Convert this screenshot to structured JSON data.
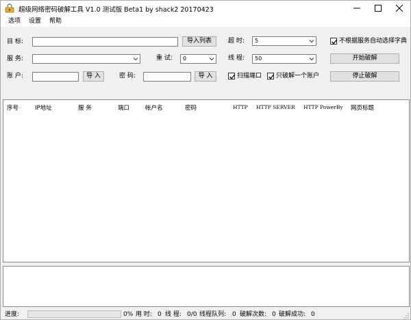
{
  "window": {
    "title": "超级网络密码破解工具 V1.0 测试版 Beta1 by shack2 20170423"
  },
  "menu": [
    "选项",
    "设置",
    "帮助"
  ],
  "form": {
    "target_label": "目 标:",
    "target_value": "",
    "import_list_button": "导入列表",
    "timeout_label": "超 时:",
    "timeout_value": "5",
    "auto_dict_label": "不根据服务自动选择字典",
    "auto_dict_checked": true,
    "service_label": "服 务:",
    "service_value": "",
    "retry_label": "重 试:",
    "retry_value": "0",
    "threads_label": "线 程:",
    "threads_value": "50",
    "start_button": "开始破解",
    "account_label": "账 户:",
    "account_value": "",
    "account_import_button": "导 入",
    "password_label": "密 码:",
    "password_value": "",
    "password_import_button": "导 入",
    "scan_port_label": "扫描端口",
    "scan_port_checked": true,
    "crack_one_label": "只破解一个账户",
    "crack_one_checked": true,
    "stop_button": "停止破解"
  },
  "table": {
    "columns": [
      "序号",
      "IP地址",
      "服 务",
      "端口",
      "帐户名",
      "密码",
      "HTTP",
      "HTTP SERVER",
      "HTTP PowerBy",
      "网页标题"
    ]
  },
  "status": {
    "progress_label": "进度:",
    "progress_percent": 0,
    "progress_text": "0%",
    "elapsed_label": "用 时:",
    "elapsed_value": "0",
    "threads_label": "线 程:",
    "threads_value": "0/0",
    "queue_label": "线程队列:",
    "queue_value": "0",
    "attempts_label": "破解次数:",
    "attempts_value": "0",
    "success_label": "破解成功:",
    "success_value": "0"
  }
}
